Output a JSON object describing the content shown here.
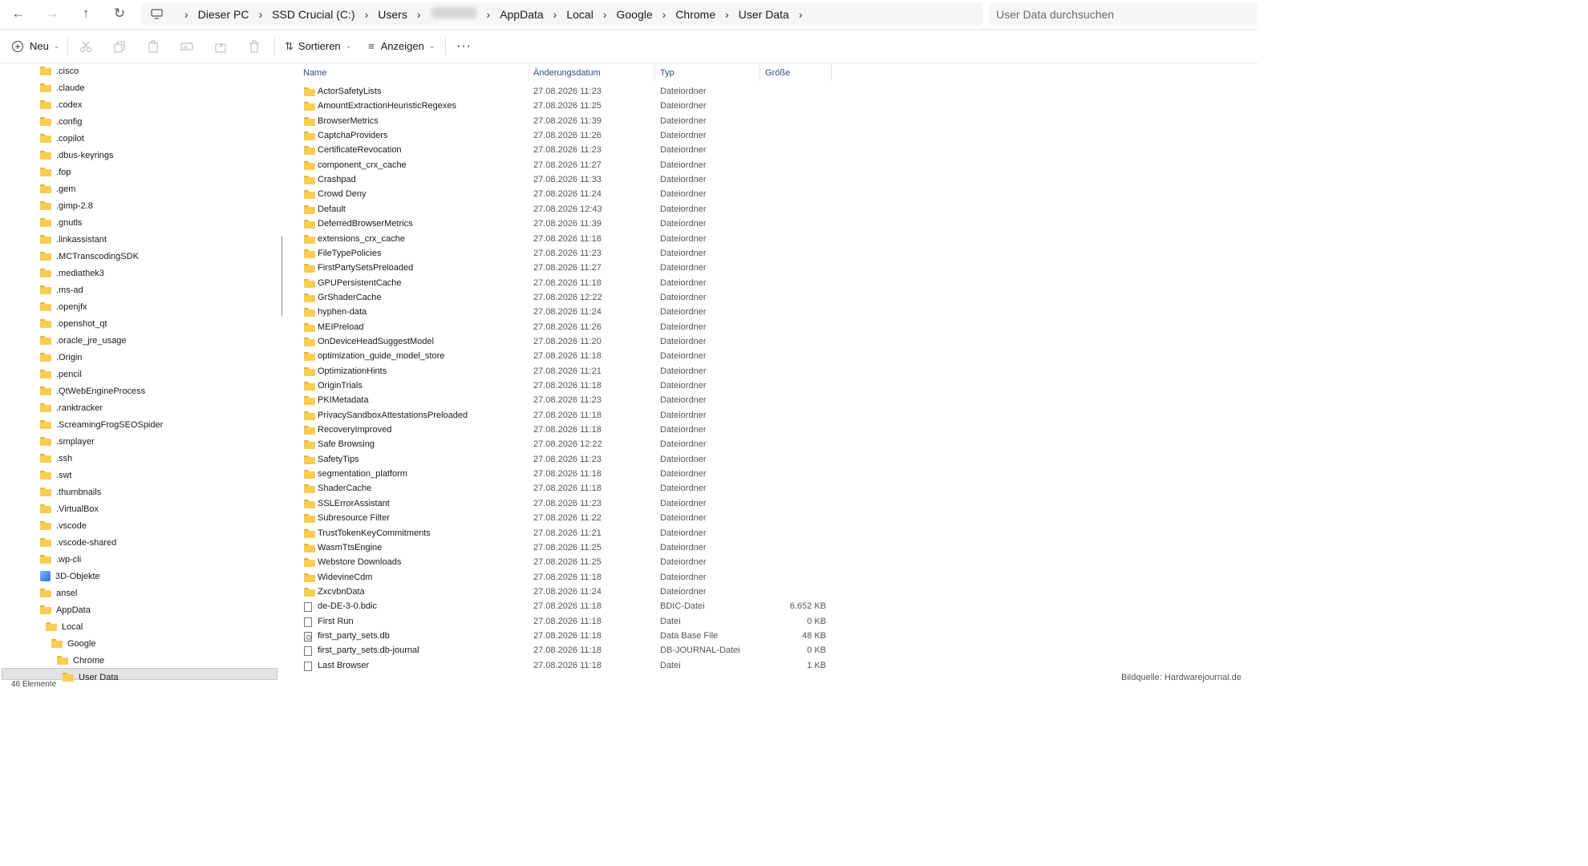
{
  "address": {
    "crumbs": [
      "Dieser PC",
      "SSD Crucial (C:)",
      "Users",
      "AppData",
      "Local",
      "Google",
      "Chrome",
      "User Data"
    ],
    "search_placeholder": "User Data durchsuchen"
  },
  "toolbar": {
    "new_label": "Neu",
    "sort_label": "Sortieren",
    "view_label": "Anzeigen",
    "more_label": "···"
  },
  "tree": {
    "items": [
      ".cisco",
      ".claude",
      ".codex",
      ".config",
      ".copilot",
      ".dbus-keyrings",
      ".fop",
      ".gem",
      ".gimp-2.8",
      ".gnutls",
      ".linkassistant",
      ".MCTranscodingSDK",
      ".mediathek3",
      ".ms-ad",
      ".openjfx",
      ".openshot_qt",
      ".oracle_jre_usage",
      ".Origin",
      ".pencil",
      ".QtWebEngineProcess",
      ".ranktracker",
      ".ScreamingFrogSEOSpider",
      ".smplayer",
      ".ssh",
      ".swt",
      ".thumbnails",
      ".VirtualBox",
      ".vscode",
      ".vscode-shared",
      ".wp-cli",
      "3D-Objekte",
      "ansel",
      "AppData",
      "Local",
      "Google",
      "Chrome",
      "User Data"
    ],
    "status": "46 Elemente"
  },
  "columns": {
    "name": "Name",
    "date": "Änderungsdatum",
    "type": "Typ",
    "size": "Größe"
  },
  "files": [
    {
      "name": "ActorSafetyLists",
      "date": "27.08.2026 11:23",
      "type": "Dateiordner",
      "size": "",
      "icon": "folder-icon"
    },
    {
      "name": "AmountExtractionHeuristicRegexes",
      "date": "27.08.2026 11:25",
      "type": "Dateiordner",
      "size": "",
      "icon": "folder-icon"
    },
    {
      "name": "BrowserMetrics",
      "date": "27.08.2026 11:39",
      "type": "Dateiordner",
      "size": "",
      "icon": "folder-icon"
    },
    {
      "name": "CaptchaProviders",
      "date": "27.08.2026 11:26",
      "type": "Dateiordner",
      "size": "",
      "icon": "folder-icon"
    },
    {
      "name": "CertificateRevocation",
      "date": "27.08.2026 11:23",
      "type": "Dateiordner",
      "size": "",
      "icon": "folder-icon"
    },
    {
      "name": "component_crx_cache",
      "date": "27.08.2026 11:27",
      "type": "Dateiordner",
      "size": "",
      "icon": "folder-icon"
    },
    {
      "name": "Crashpad",
      "date": "27.08.2026 11:33",
      "type": "Dateiordner",
      "size": "",
      "icon": "folder-icon"
    },
    {
      "name": "Crowd Deny",
      "date": "27.08.2026 11:24",
      "type": "Dateiordner",
      "size": "",
      "icon": "folder-icon"
    },
    {
      "name": "Default",
      "date": "27.08.2026 12:43",
      "type": "Dateiordner",
      "size": "",
      "icon": "folder-icon"
    },
    {
      "name": "DeferredBrowserMetrics",
      "date": "27.08.2026 11:39",
      "type": "Dateiordner",
      "size": "",
      "icon": "folder-icon"
    },
    {
      "name": "extensions_crx_cache",
      "date": "27.08.2026 11:18",
      "type": "Dateiordner",
      "size": "",
      "icon": "folder-icon"
    },
    {
      "name": "FileTypePolicies",
      "date": "27.08.2026 11:23",
      "type": "Dateiordner",
      "size": "",
      "icon": "folder-icon"
    },
    {
      "name": "FirstPartySetsPreloaded",
      "date": "27.08.2026 11:27",
      "type": "Dateiordner",
      "size": "",
      "icon": "folder-icon"
    },
    {
      "name": "GPUPersistentCache",
      "date": "27.08.2026 11:18",
      "type": "Dateiordner",
      "size": "",
      "icon": "folder-icon"
    },
    {
      "name": "GrShaderCache",
      "date": "27.08.2026 12:22",
      "type": "Dateiordner",
      "size": "",
      "icon": "folder-icon"
    },
    {
      "name": "hyphen-data",
      "date": "27.08.2026 11:24",
      "type": "Dateiordner",
      "size": "",
      "icon": "folder-icon"
    },
    {
      "name": "MEIPreload",
      "date": "27.08.2026 11:26",
      "type": "Dateiordner",
      "size": "",
      "icon": "folder-icon"
    },
    {
      "name": "OnDeviceHeadSuggestModel",
      "date": "27.08.2026 11:20",
      "type": "Dateiordner",
      "size": "",
      "icon": "folder-icon"
    },
    {
      "name": "optimization_guide_model_store",
      "date": "27.08.2026 11:18",
      "type": "Dateiordner",
      "size": "",
      "icon": "folder-icon"
    },
    {
      "name": "OptimizationHints",
      "date": "27.08.2026 11:21",
      "type": "Dateiordner",
      "size": "",
      "icon": "folder-icon"
    },
    {
      "name": "OriginTrials",
      "date": "27.08.2026 11:18",
      "type": "Dateiordner",
      "size": "",
      "icon": "folder-icon"
    },
    {
      "name": "PKIMetadata",
      "date": "27.08.2026 11:23",
      "type": "Dateiordner",
      "size": "",
      "icon": "folder-icon"
    },
    {
      "name": "PrivacySandboxAttestationsPreloaded",
      "date": "27.08.2026 11:18",
      "type": "Dateiordner",
      "size": "",
      "icon": "folder-icon"
    },
    {
      "name": "RecoveryImproved",
      "date": "27.08.2026 11:18",
      "type": "Dateiordner",
      "size": "",
      "icon": "folder-icon"
    },
    {
      "name": "Safe Browsing",
      "date": "27.08.2026 12:22",
      "type": "Dateiordner",
      "size": "",
      "icon": "folder-icon"
    },
    {
      "name": "SafetyTips",
      "date": "27.08.2026 11:23",
      "type": "Dateiordner",
      "size": "",
      "icon": "folder-icon"
    },
    {
      "name": "segmentation_platform",
      "date": "27.08.2026 11:18",
      "type": "Dateiordner",
      "size": "",
      "icon": "folder-icon"
    },
    {
      "name": "ShaderCache",
      "date": "27.08.2026 11:18",
      "type": "Dateiordner",
      "size": "",
      "icon": "folder-icon"
    },
    {
      "name": "SSLErrorAssistant",
      "date": "27.08.2026 11:23",
      "type": "Dateiordner",
      "size": "",
      "icon": "folder-icon"
    },
    {
      "name": "Subresource Filter",
      "date": "27.08.2026 11:22",
      "type": "Dateiordner",
      "size": "",
      "icon": "folder-icon"
    },
    {
      "name": "TrustTokenKeyCommitments",
      "date": "27.08.2026 11:21",
      "type": "Dateiordner",
      "size": "",
      "icon": "folder-icon"
    },
    {
      "name": "WasmTtsEngine",
      "date": "27.08.2026 11:25",
      "type": "Dateiordner",
      "size": "",
      "icon": "folder-icon"
    },
    {
      "name": "Webstore Downloads",
      "date": "27.08.2026 11:25",
      "type": "Dateiordner",
      "size": "",
      "icon": "folder-icon"
    },
    {
      "name": "WidevineCdm",
      "date": "27.08.2026 11:18",
      "type": "Dateiordner",
      "size": "",
      "icon": "folder-icon"
    },
    {
      "name": "ZxcvbnData",
      "date": "27.08.2026 11:24",
      "type": "Dateiordner",
      "size": "",
      "icon": "folder-icon"
    },
    {
      "name": "de-DE-3-0.bdic",
      "date": "27.08.2026 11:18",
      "type": "BDIC-Datei",
      "size": "6.652 KB",
      "icon": "file-icon"
    },
    {
      "name": "First Run",
      "date": "27.08.2026 11:18",
      "type": "Datei",
      "size": "0 KB",
      "icon": "file-icon"
    },
    {
      "name": "first_party_sets.db",
      "date": "27.08.2026 11:18",
      "type": "Data Base File",
      "size": "48 KB",
      "icon": "database-file-icon"
    },
    {
      "name": "first_party_sets.db-journal",
      "date": "27.08.2026 11:18",
      "type": "DB-JOURNAL-Datei",
      "size": "0 KB",
      "icon": "file-icon"
    },
    {
      "name": "Last Browser",
      "date": "27.08.2026 11:18",
      "type": "Datei",
      "size": "1 KB",
      "icon": "file-icon"
    }
  ],
  "watermark": "Bildquelle: Hardwarejournal.de"
}
